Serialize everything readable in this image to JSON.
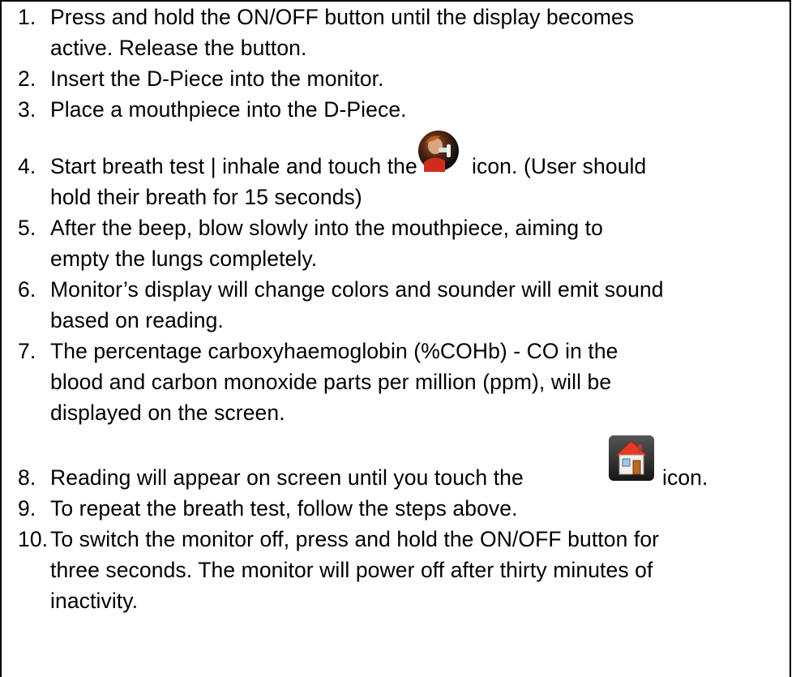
{
  "steps": [
    {
      "num": "1.",
      "lines": [
        "Press and hold the ON/OFF button until the display becomes",
        "active.  Release the button."
      ]
    },
    {
      "num": "2.",
      "lines": [
        "Insert the D-Piece into the monitor."
      ]
    },
    {
      "num": "3.",
      "lines": [
        "Place a mouthpiece into the D-Piece."
      ]
    },
    {
      "num": "4.",
      "lines_a": "Start breath test | inhale and touch the",
      "lines_b": "icon. (User should",
      "lines": [
        "hold their breath for 15 seconds)"
      ]
    },
    {
      "num": "5.",
      "lines": [
        "After the beep, blow slowly into the mouthpiece, aiming to",
        "empty the lungs completely."
      ]
    },
    {
      "num": "6.",
      "lines": [
        "Monitor’s display will change colors and sounder will emit sound",
        "based on reading."
      ]
    },
    {
      "num": "7.",
      "lines": [
        "The percentage carboxyhaemoglobin (%COHb) - CO in the",
        "blood and carbon monoxide parts per million (ppm), will be",
        "displayed on the screen."
      ]
    },
    {
      "num": "8.",
      "lines_a": "Reading will appear on screen until you touch the",
      "lines_b": "icon."
    },
    {
      "num": "9.",
      "lines": [
        "To repeat the breath test, follow the steps above."
      ]
    },
    {
      "num": "10.",
      "lines": [
        "To switch the monitor off, press and hold the ON/OFF button for",
        "three seconds.  The monitor will power off after thirty minutes of",
        "inactivity."
      ]
    }
  ],
  "icons": {
    "breath_test": "breath-test-icon",
    "home": "home-icon"
  }
}
